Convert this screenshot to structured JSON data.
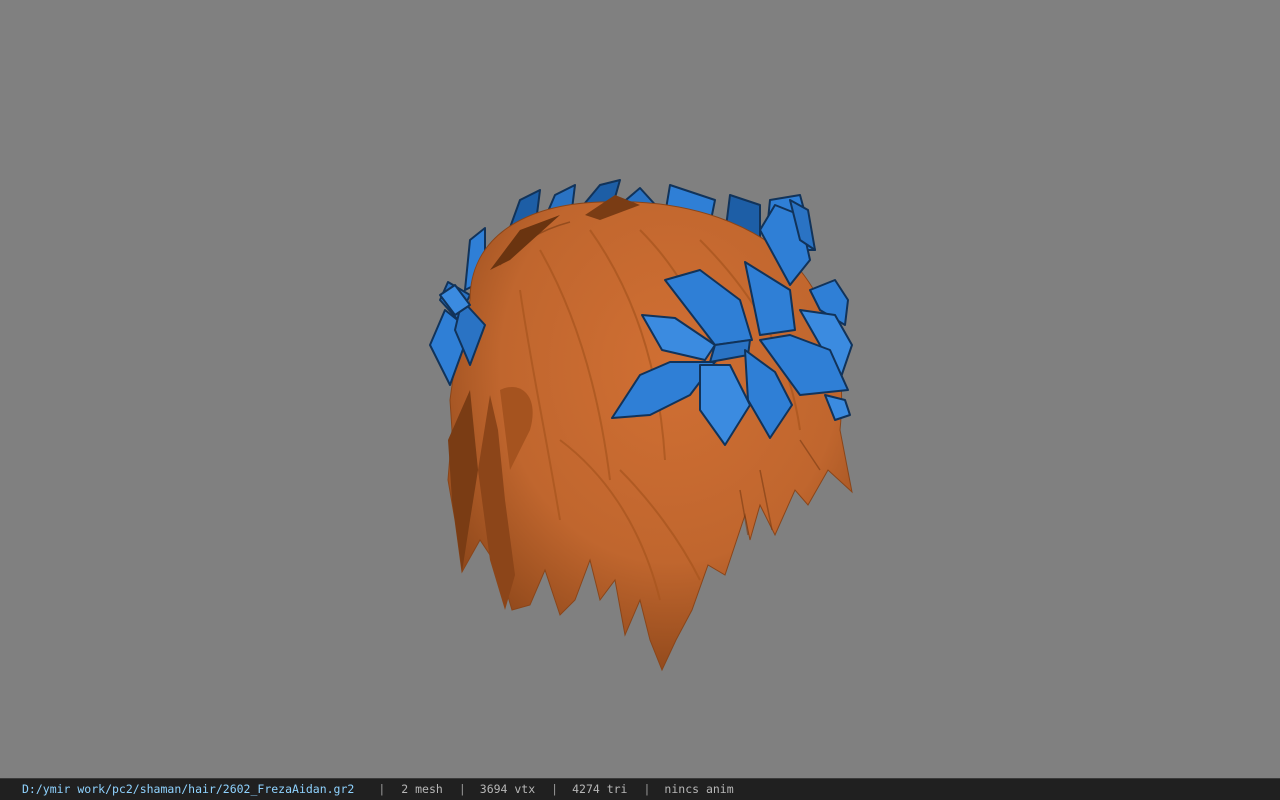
{
  "viewport": {
    "background_color": "#808080",
    "model": {
      "hair_color": "#c0662e",
      "hair_shadow_color": "#7a3c14",
      "leaf_color": "#2f7fd6",
      "leaf_dark_color": "#1d5ea6",
      "leaf_outline_color": "#11335a"
    }
  },
  "status": {
    "file_path": "D:/ymir work/pc2/shaman/hair/2602_FrezaAidan.gr2",
    "separator": "|",
    "mesh_count": "2 mesh",
    "vertex_count": "3694 vtx",
    "triangle_count": "4274 tri",
    "anim_status": "nincs anim"
  }
}
